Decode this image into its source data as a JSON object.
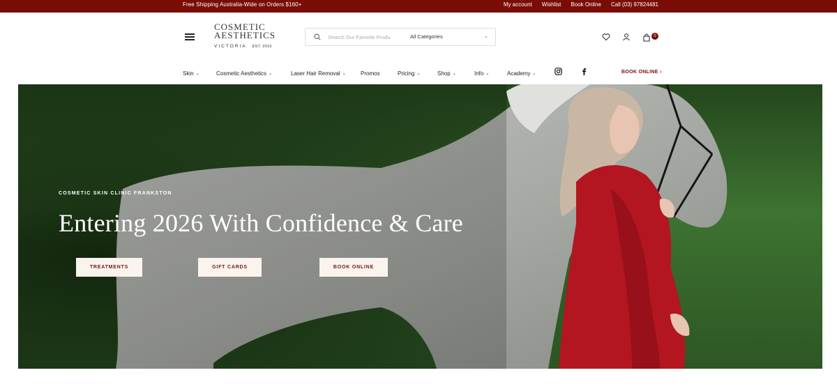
{
  "topbar": {
    "promo": "Free Shipping Australia-Wide on Orders $160+",
    "links": [
      "My account",
      "Wishlist",
      "Book Online",
      "Call (03) 97824481"
    ]
  },
  "logo": {
    "line1": "COSMETIC",
    "line2": "AESTHETICS",
    "line3": "VICTORIA",
    "est": "EST. 2016"
  },
  "search": {
    "placeholder": "Search Our Favorite Produ",
    "category": "All Categories"
  },
  "cart": {
    "count": "0"
  },
  "nav": {
    "items": [
      "Skin",
      "Cosmetic Aesthetics",
      "Laser Hair Removal",
      "Promos",
      "Pricing",
      "Shop",
      "Info",
      "Academy"
    ],
    "book_online": "BOOK ONLINE ›"
  },
  "hero": {
    "eyebrow": "COSMETIC SKIN CLINIC FRANKSTON",
    "headline": "Entering 2026 With Confidence & Care",
    "buttons": [
      "TREATMENTS",
      "GIFT CARDS",
      "BOOK ONLINE"
    ]
  },
  "colors": {
    "brand": "#7a0c06",
    "button_bg": "#fbf3ee",
    "button_text": "#6b1a14"
  },
  "icons": [
    "menu-icon",
    "search-icon",
    "chevron-down-icon",
    "heart-icon",
    "user-icon",
    "cart-icon",
    "instagram-icon",
    "facebook-icon"
  ]
}
